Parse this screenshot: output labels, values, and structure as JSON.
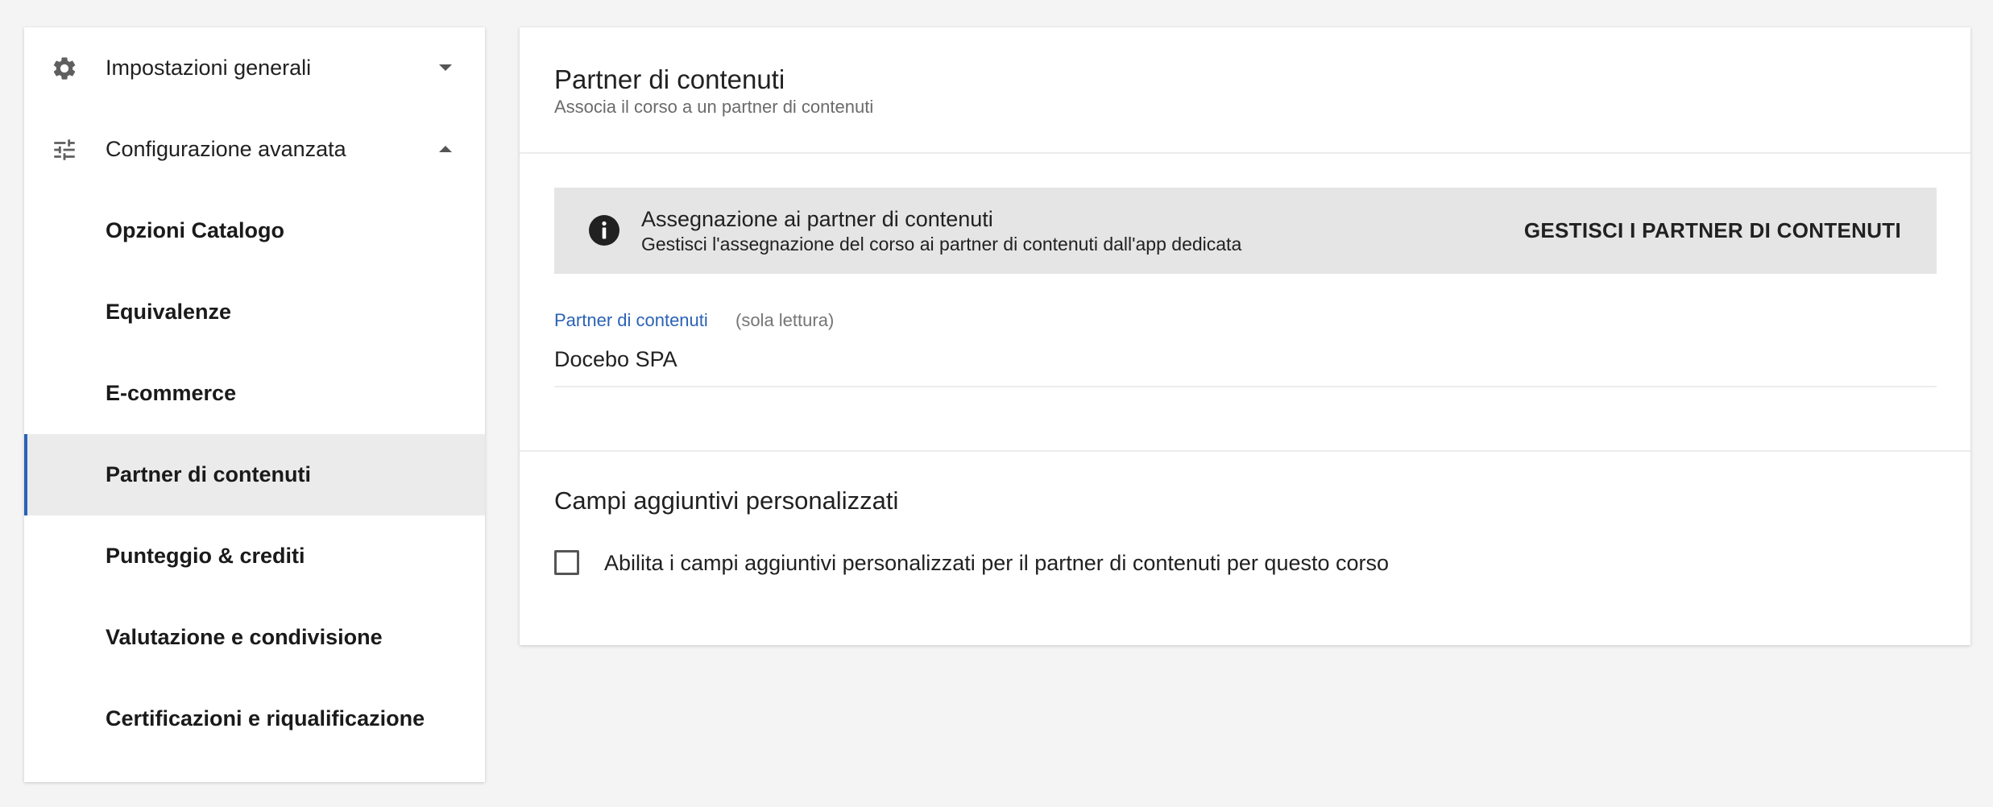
{
  "sidebar": {
    "groups": [
      {
        "label": "Impostazioni generali",
        "icon": "gear-icon",
        "state": "collapsed"
      },
      {
        "label": "Configurazione avanzata",
        "icon": "tune-icon",
        "state": "expanded"
      }
    ],
    "items": [
      {
        "label": "Opzioni Catalogo"
      },
      {
        "label": "Equivalenze"
      },
      {
        "label": "E-commerce"
      },
      {
        "label": "Partner di contenuti",
        "active": true
      },
      {
        "label": "Punteggio & crediti"
      },
      {
        "label": "Valutazione e condivisione"
      },
      {
        "label": "Certificazioni e riqualificazione"
      }
    ]
  },
  "main": {
    "title": "Partner di contenuti",
    "subtitle": "Associa il corso a un partner di contenuti",
    "banner": {
      "icon": "info-icon",
      "title": "Assegnazione ai partner di contenuti",
      "description": "Gestisci l'assegnazione del corso ai partner di contenuti dall'app dedicata",
      "action_label": "GESTISCI I PARTNER DI CONTENUTI"
    },
    "field": {
      "label": "Partner di contenuti",
      "note": "(sola lettura)",
      "value": "Docebo SPA"
    },
    "custom_fields": {
      "title": "Campi aggiuntivi personalizzati",
      "checkbox_label": "Abilita i campi aggiuntivi personalizzati per il partner di contenuti per questo corso",
      "checked": false
    }
  },
  "colors": {
    "accent": "#2b62b6",
    "banner_bg": "#e4e5e4",
    "page_bg": "#f4f4f4",
    "active_item_bg": "#ebebeb"
  }
}
